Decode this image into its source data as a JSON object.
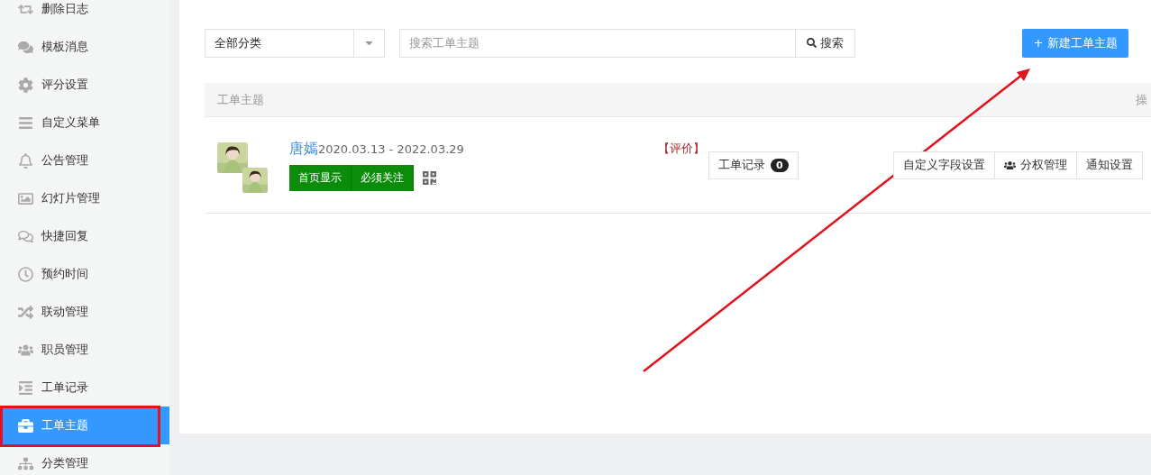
{
  "sidebar": {
    "items": [
      {
        "label": "删除日志",
        "selected": false
      },
      {
        "label": "模板消息",
        "selected": false
      },
      {
        "label": "评分设置",
        "selected": false
      },
      {
        "label": "自定义菜单",
        "selected": false
      },
      {
        "label": "公告管理",
        "selected": false
      },
      {
        "label": "幻灯片管理",
        "selected": false
      },
      {
        "label": "快捷回复",
        "selected": false
      },
      {
        "label": "预约时间",
        "selected": false
      },
      {
        "label": "联动管理",
        "selected": false
      },
      {
        "label": "职员管理",
        "selected": false
      },
      {
        "label": "工单记录",
        "selected": false
      },
      {
        "label": "工单主题",
        "selected": true
      },
      {
        "label": "分类管理",
        "selected": false
      }
    ]
  },
  "filter": {
    "category": "全部分类",
    "search_placeholder": "搜索工单主题",
    "search_button": "搜索"
  },
  "new_button": "+ 新建工单主题",
  "table": {
    "columns": [
      "工单主题",
      "操"
    ],
    "rows": [
      {
        "name": "唐嫣",
        "dates": "2020.03.13 - 2022.03.29",
        "tags": [
          "首页显示",
          "必须关注"
        ],
        "rating_link": "【评价】",
        "records_button": {
          "label": "工单记录",
          "count": "0"
        },
        "actions": [
          {
            "label": "自定义字段设置",
            "kind": "text"
          },
          {
            "label": "分权管理",
            "kind": "users"
          },
          {
            "label": "通知设置",
            "kind": "text"
          }
        ]
      }
    ]
  },
  "annotations": {
    "highlight_box": true,
    "arrow": true
  }
}
